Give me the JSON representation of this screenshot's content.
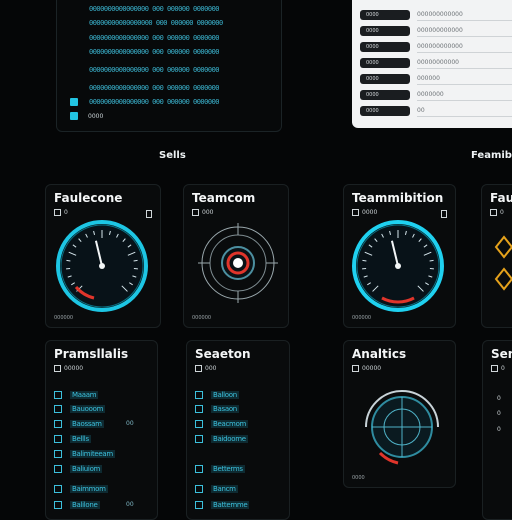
{
  "log_panel": {
    "lines": [
      "0000000000000000  000  000000  0000000",
      "00000000000000000 000  000000  0000000",
      "0000000000000000  000  000000  0000000",
      "0000000000000000  000  000000  0000000",
      "0000000000000000  000  000000  0000000",
      "0000000000000000  000  000000  0000000",
      "0000000000000000  000  000000  0000000"
    ],
    "footer": "0000"
  },
  "form_panel": {
    "rows": [
      {
        "label": "0000",
        "value": "000000000000"
      },
      {
        "label": "0000",
        "value": "000000000000"
      },
      {
        "label": "0000",
        "value": "000000000000"
      },
      {
        "label": "0000",
        "value": "00000000000"
      },
      {
        "label": "0000",
        "value": "000000"
      },
      {
        "label": "0000",
        "value": "0000000"
      },
      {
        "label": "0000",
        "value": "00"
      }
    ]
  },
  "sections": {
    "left": "Sells",
    "right": "Feamibe"
  },
  "cards_top": {
    "c1": {
      "title": "Faulecone",
      "sub": "0",
      "foot": "000000"
    },
    "c2": {
      "title": "Teamcom",
      "sub": "000",
      "foot": "000000"
    },
    "c3": {
      "title": "Teammibition",
      "sub": "0000",
      "foot": "000000"
    },
    "c4": {
      "title": "Faule",
      "sub": "0"
    }
  },
  "cards_bottom": {
    "c1": {
      "title": "Pramsllalis",
      "sub": "00000",
      "items": [
        {
          "label": "Maaam",
          "tag": ""
        },
        {
          "label": "Bauooom",
          "tag": ""
        },
        {
          "label": "Baossam",
          "tag": "00"
        },
        {
          "label": "Bellls",
          "tag": ""
        },
        {
          "label": "Balimiteeam",
          "tag": ""
        },
        {
          "label": "Baliuiom",
          "tag": ""
        },
        {
          "label": "Baimmom",
          "tag": ""
        },
        {
          "label": "Balilone",
          "tag": "00"
        }
      ]
    },
    "c2": {
      "title": "Seaeton",
      "sub": "000",
      "items": [
        {
          "label": "Balloon"
        },
        {
          "label": "Basaon"
        },
        {
          "label": "Beacmom"
        },
        {
          "label": "Baidoome"
        },
        {
          "label": "Betterms"
        },
        {
          "label": "Bancm"
        },
        {
          "label": "Battemme"
        }
      ]
    },
    "c3": {
      "title": "Analtics",
      "sub": "00000",
      "foot": "0000"
    },
    "c4": {
      "title": "Sen",
      "sub": "0",
      "items": [
        "0",
        "0",
        "0"
      ]
    }
  },
  "gauges": {
    "speed_value": 45,
    "speed_max": 100,
    "accent": "#1fd1f0",
    "danger": "#e0352b"
  },
  "colors": {
    "bg": "#050607",
    "accent": "#22c4e2",
    "warning": "#e5a21b"
  }
}
